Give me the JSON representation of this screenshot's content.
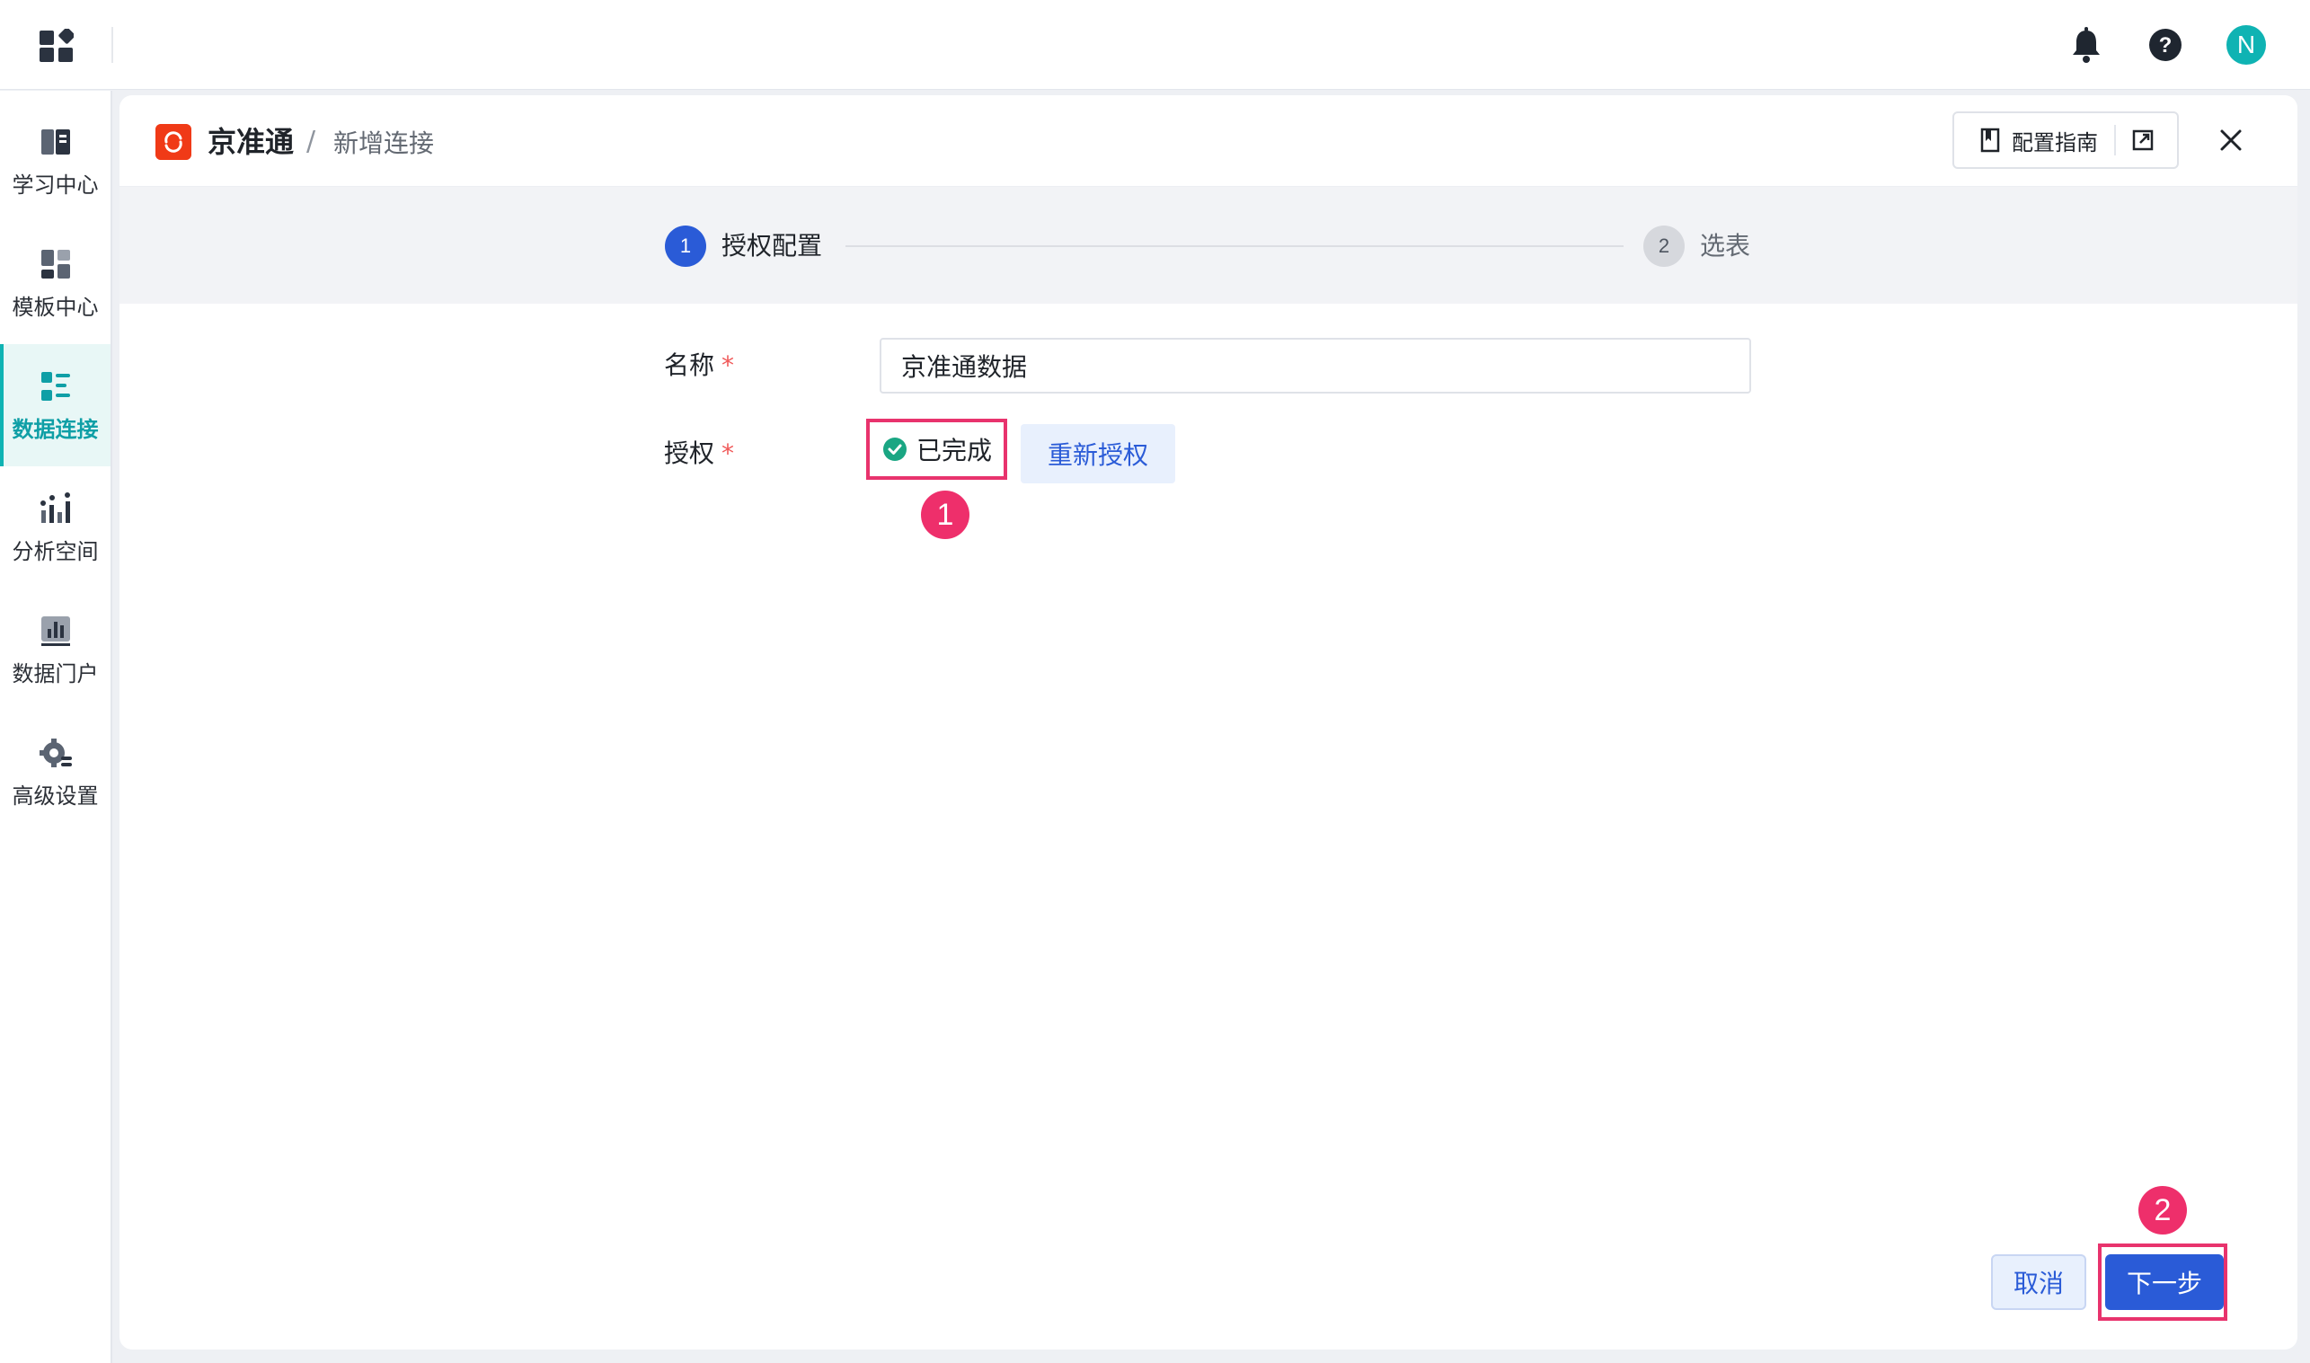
{
  "topbar": {
    "avatar_letter": "N"
  },
  "sidebar": {
    "items": [
      {
        "label": "学习中心",
        "icon": "book-icon"
      },
      {
        "label": "模板中心",
        "icon": "template-icon"
      },
      {
        "label": "数据连接",
        "icon": "data-connection-icon",
        "active": true
      },
      {
        "label": "分析空间",
        "icon": "analysis-icon"
      },
      {
        "label": "数据门户",
        "icon": "bar-chart-icon"
      },
      {
        "label": "高级设置",
        "icon": "settings-gear-icon"
      }
    ]
  },
  "header": {
    "brand": "京准通",
    "separator": "/",
    "subtitle": "新增连接",
    "guide_label": "配置指南"
  },
  "steps": [
    {
      "number": "1",
      "label": "授权配置",
      "active": true
    },
    {
      "number": "2",
      "label": "选表",
      "active": false
    }
  ],
  "form": {
    "name_label": "名称",
    "name_value": "京准通数据",
    "auth_label": "授权",
    "required_mark": "*",
    "auth_status": "已完成",
    "reauth_label": "重新授权"
  },
  "annotations": {
    "marker1": "1",
    "marker2": "2"
  },
  "footer": {
    "cancel_label": "取消",
    "next_label": "下一步"
  },
  "colors": {
    "accent": "#2a5bd7",
    "teal": "#0fb3b3",
    "highlight": "#e8336d",
    "success": "#1aa683",
    "brand_red": "#f03a17"
  }
}
